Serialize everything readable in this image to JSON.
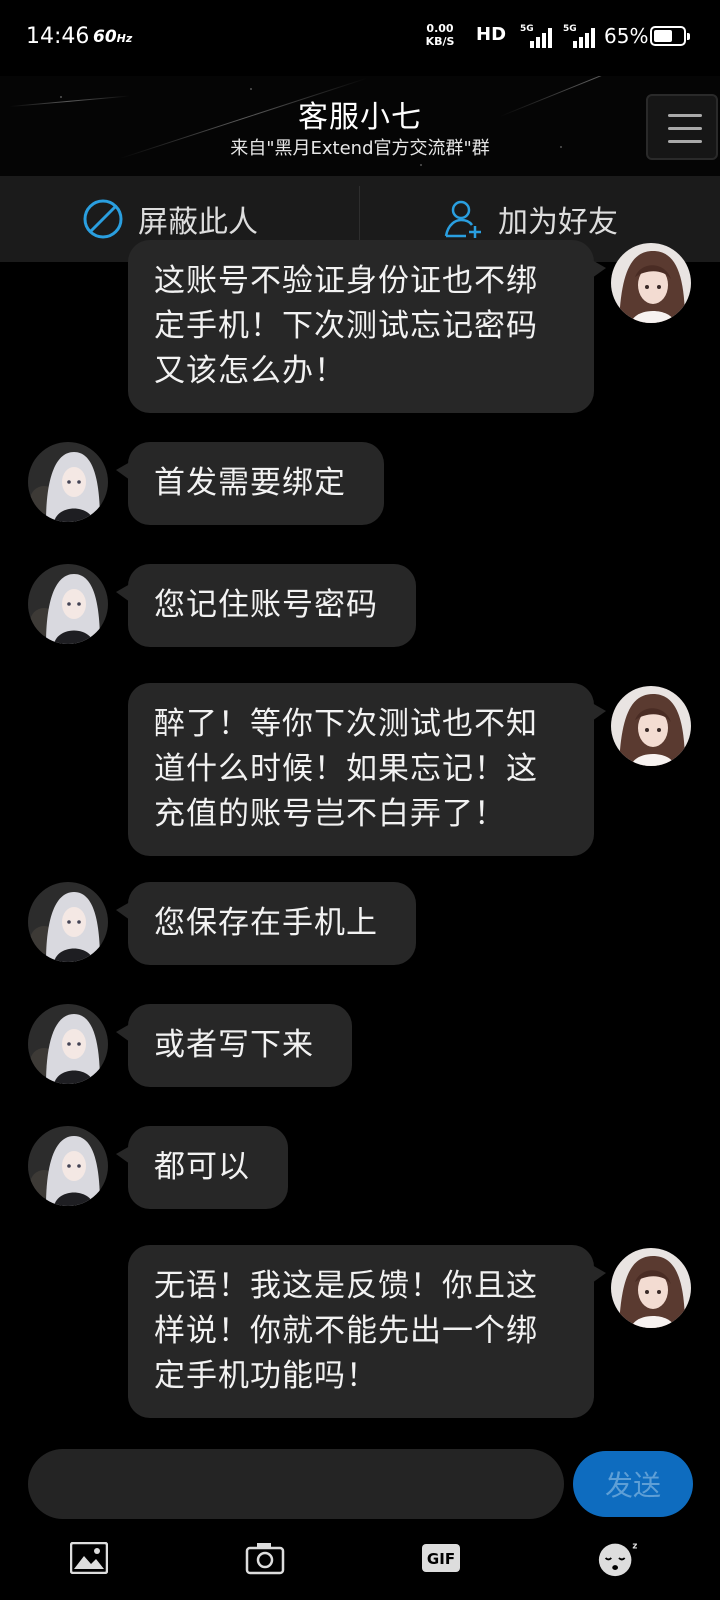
{
  "status_bar": {
    "time": "14:46",
    "refresh_rate": "60",
    "refresh_unit": "Hz",
    "net_speed_value": "0.00",
    "net_speed_unit": "KB/S",
    "hd_label": "HD",
    "sim1_tag": "5G",
    "sim2_tag": "5G",
    "battery_text": "65%",
    "battery_level": 0.65
  },
  "header": {
    "title": "客服小七",
    "subtitle": "来自\"黑月Extend官方交流群\"群",
    "menu_icon": "hamburger-menu-icon"
  },
  "actions": {
    "block_label": "屏蔽此人",
    "block_icon": "block-icon",
    "add_friend_label": "加为好友",
    "add_friend_icon": "add-person-icon",
    "accent_color": "#2a9fe0"
  },
  "messages": [
    {
      "from": "me",
      "text": "这账号不验证身份证也不绑\n定手机！下次测试忘记密码\n又该怎么办！"
    },
    {
      "from": "them",
      "text": "首发需要绑定"
    },
    {
      "from": "them",
      "text": "您记住账号密码"
    },
    {
      "from": "me",
      "text": "醉了！等你下次测试也不知\n道什么时候！如果忘记！这\n充值的账号岂不白弄了！"
    },
    {
      "from": "them",
      "text": "您保存在手机上"
    },
    {
      "from": "them",
      "text": "或者写下来"
    },
    {
      "from": "them",
      "text": "都可以"
    },
    {
      "from": "me",
      "text": "无语！我这是反馈！你且这\n样说！你就不能先出一个绑\n定手机功能吗！"
    }
  ],
  "composer": {
    "input_value": "",
    "send_label": "发送",
    "send_color": "#0e6cbf"
  },
  "toolbar": {
    "items": [
      {
        "icon": "image-icon"
      },
      {
        "icon": "camera-icon"
      },
      {
        "icon": "gif-icon",
        "label": "GIF"
      },
      {
        "icon": "emoji-icon"
      }
    ]
  }
}
